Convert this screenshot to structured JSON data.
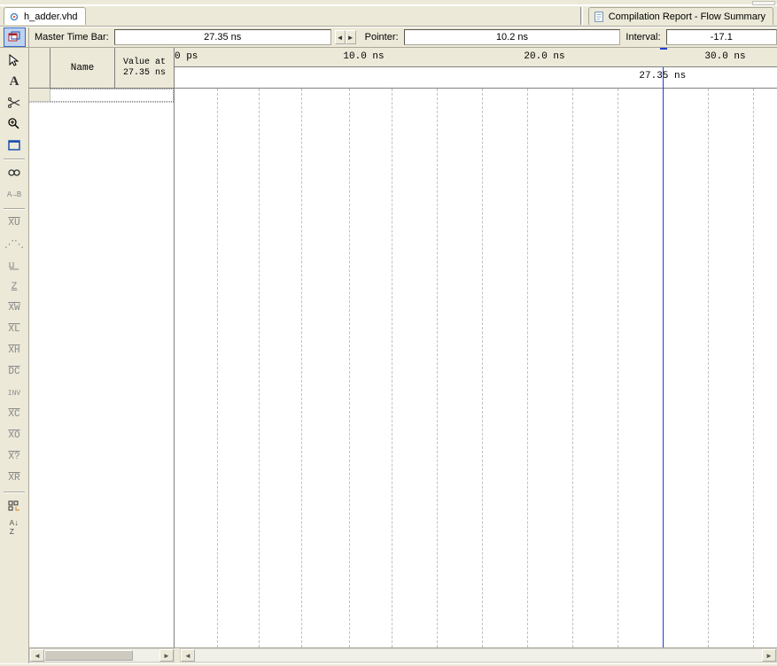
{
  "tabs": {
    "file_tab_label": "h_adder.vhd",
    "report_tab_label": "Compilation Report - Flow Summary"
  },
  "timebar": {
    "master_label": "Master Time Bar:",
    "master_value": "27.35 ns",
    "pointer_label": "Pointer:",
    "pointer_value": "10.2 ns",
    "interval_label": "Interval:",
    "interval_value": "-17.1"
  },
  "signal_header": {
    "name_col": "Name",
    "value_col": "Value at\n27.35 ns"
  },
  "ruler": {
    "ticks": [
      {
        "label": "0 ps",
        "left_pct": 0
      },
      {
        "label": "10.0 ns",
        "left_pct": 28
      },
      {
        "label": "20.0 ns",
        "left_pct": 58
      },
      {
        "label": "30.0 ns",
        "left_pct": 88
      }
    ],
    "cursor_label": "27.35 ns",
    "cursor_left_pct": 81
  },
  "grid_lines_pct": [
    7,
    14,
    21,
    29,
    36,
    43.5,
    51,
    58.5,
    66,
    73.5,
    81,
    88.5,
    96
  ],
  "toolbar": {
    "icons": [
      "detach-window",
      "pointer",
      "text-a",
      "cut-tool",
      "zoom",
      "full-screen",
      "sep",
      "binoculars",
      "goto-ab",
      "sep",
      "xu1",
      "dots-tool",
      "step-tool",
      "z-tool",
      "xw-tool",
      "xl-tool",
      "xb-tool",
      "ac-tool",
      "inv-tool",
      "xc-tool",
      "xo-tool",
      "xq-tool",
      "xr-tool",
      "sep",
      "grid-tool",
      "sort-tool"
    ]
  }
}
